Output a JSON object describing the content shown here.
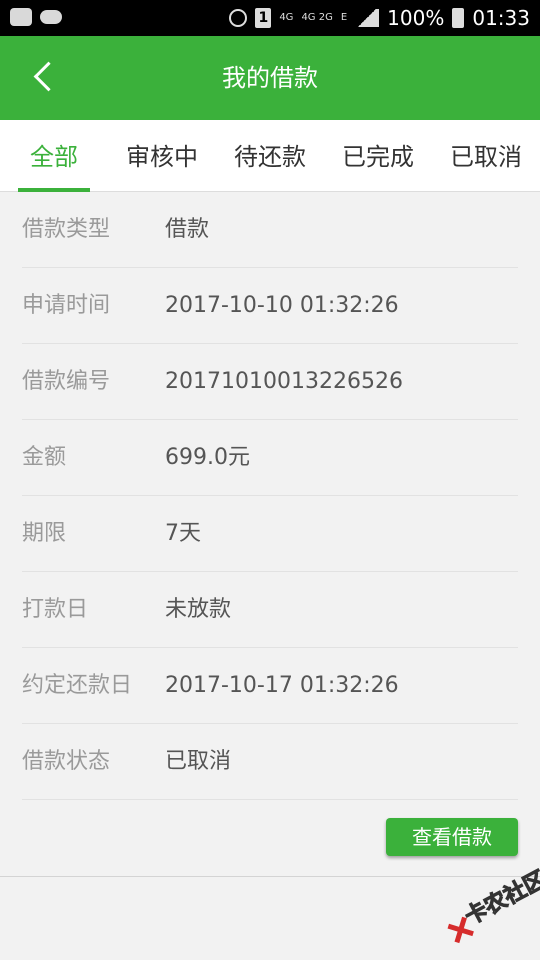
{
  "status_bar": {
    "sim_slot": "1",
    "network_1": "4G",
    "network_2": "4G 2G",
    "data_type": "E",
    "battery": "100%",
    "time": "01:33"
  },
  "header": {
    "title": "我的借款",
    "back_icon": "chevron-left-icon"
  },
  "tabs": [
    {
      "label": "全部",
      "active": true
    },
    {
      "label": "审核中",
      "active": false
    },
    {
      "label": "待还款",
      "active": false
    },
    {
      "label": "已完成",
      "active": false
    },
    {
      "label": "已取消",
      "active": false
    }
  ],
  "loan_details": [
    {
      "label": "借款类型",
      "value": "借款"
    },
    {
      "label": "申请时间",
      "value": "2017-10-10 01:32:26"
    },
    {
      "label": "借款编号",
      "value": "20171010013226526"
    },
    {
      "label": "金额",
      "value": "699.0元"
    },
    {
      "label": "期限",
      "value": "7天"
    },
    {
      "label": "打款日",
      "value": "未放款"
    },
    {
      "label": "约定还款日",
      "value": "2017-10-17 01:32:26"
    },
    {
      "label": "借款状态",
      "value": "已取消"
    }
  ],
  "actions": {
    "view_loan_label": "查看借款"
  },
  "watermark": {
    "text": "卡农社区"
  },
  "colors": {
    "accent": "#3bb13b",
    "label": "#9a9a9a",
    "value": "#555555",
    "background": "#f2f2f2"
  }
}
